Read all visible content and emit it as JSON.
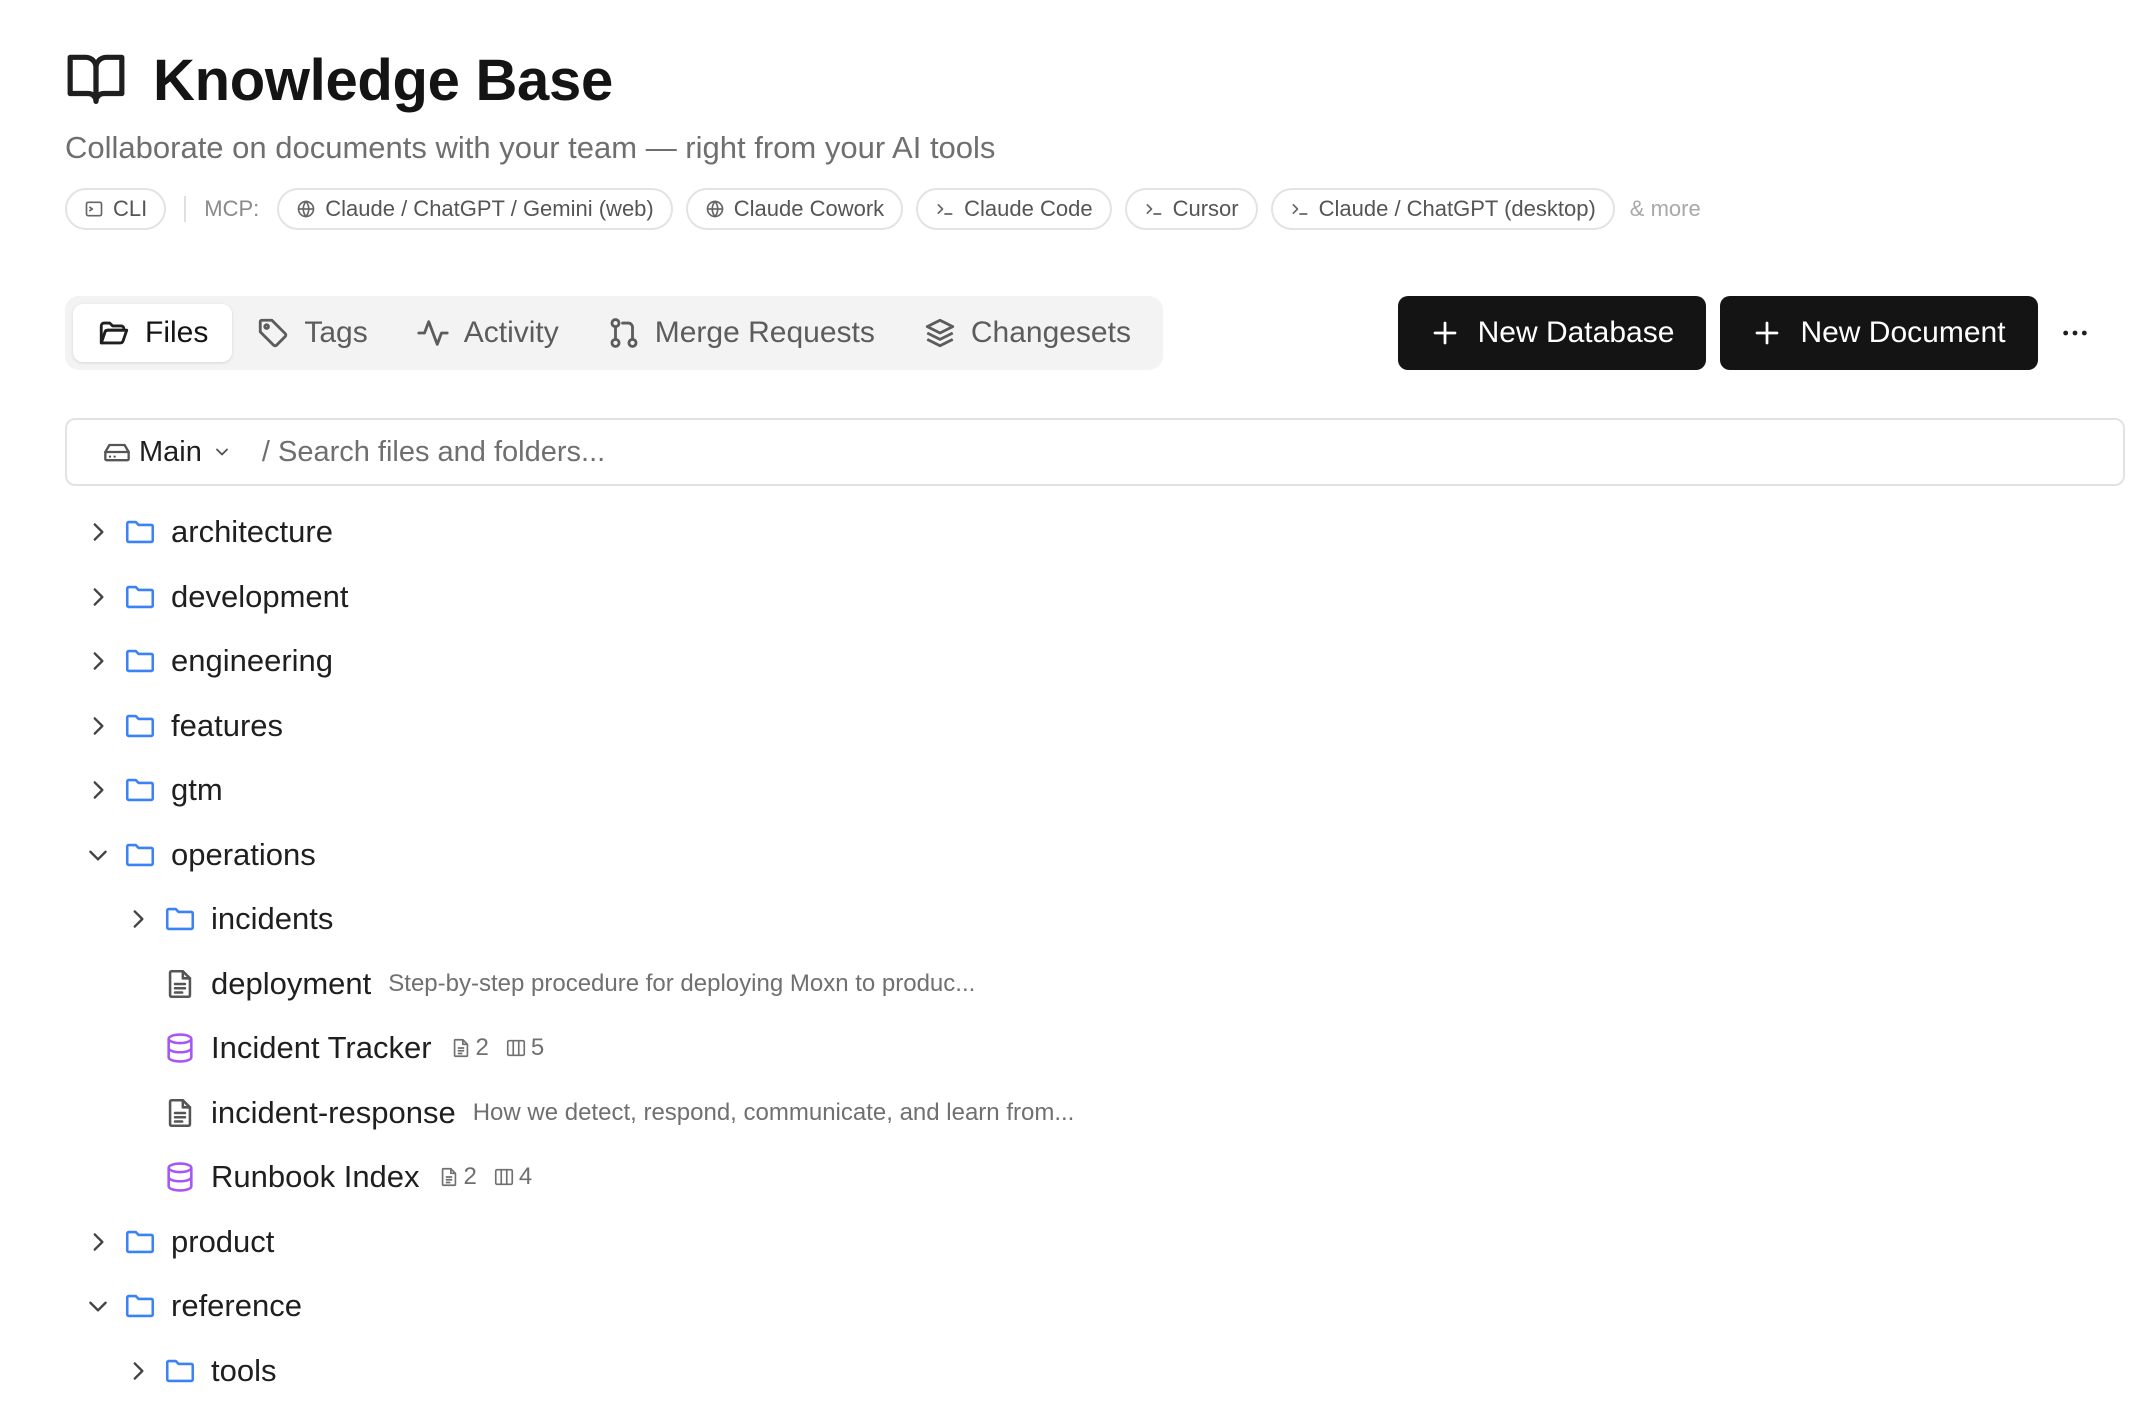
{
  "header": {
    "title": "Knowledge Base",
    "subtitle": "Collaborate on documents with your team — right from your AI tools"
  },
  "integrations": {
    "cli_label": "CLI",
    "mcp_label": "MCP:",
    "chips": [
      {
        "label": "Claude / ChatGPT / Gemini (web)",
        "icon": "globe-icon"
      },
      {
        "label": "Claude Cowork",
        "icon": "globe-icon"
      },
      {
        "label": "Claude Code",
        "icon": "terminal-icon"
      },
      {
        "label": "Cursor",
        "icon": "terminal-icon"
      },
      {
        "label": "Claude / ChatGPT (desktop)",
        "icon": "terminal-icon"
      }
    ],
    "more_label": "& more"
  },
  "tabs": [
    {
      "label": "Files",
      "icon": "folder-open-icon",
      "active": true
    },
    {
      "label": "Tags",
      "icon": "tag-icon"
    },
    {
      "label": "Activity",
      "icon": "activity-icon"
    },
    {
      "label": "Merge Requests",
      "icon": "git-pull-request-icon"
    },
    {
      "label": "Changesets",
      "icon": "layers-icon"
    }
  ],
  "actions": {
    "new_database": "New Database",
    "new_document": "New Document"
  },
  "search": {
    "branch": "Main",
    "placeholder": "/ Search files and folders..."
  },
  "tree": {
    "architecture": "architecture",
    "development": "development",
    "engineering": "engineering",
    "features": "features",
    "gtm": "gtm",
    "operations": "operations",
    "incidents": "incidents",
    "deployment": {
      "name": "deployment",
      "desc": "Step-by-step procedure for deploying Moxn to produc..."
    },
    "incident_tracker": {
      "name": "Incident Tracker",
      "docs": "2",
      "cols": "5"
    },
    "incident_response": {
      "name": "incident-response",
      "desc": "How we detect, respond, communicate, and learn from..."
    },
    "runbook_index": {
      "name": "Runbook Index",
      "docs": "2",
      "cols": "4"
    },
    "product": "product",
    "reference": "reference",
    "tools": "tools"
  },
  "colors": {
    "folder": "#3b82f6",
    "database": "#a855f7",
    "primary_button": "#141414"
  }
}
